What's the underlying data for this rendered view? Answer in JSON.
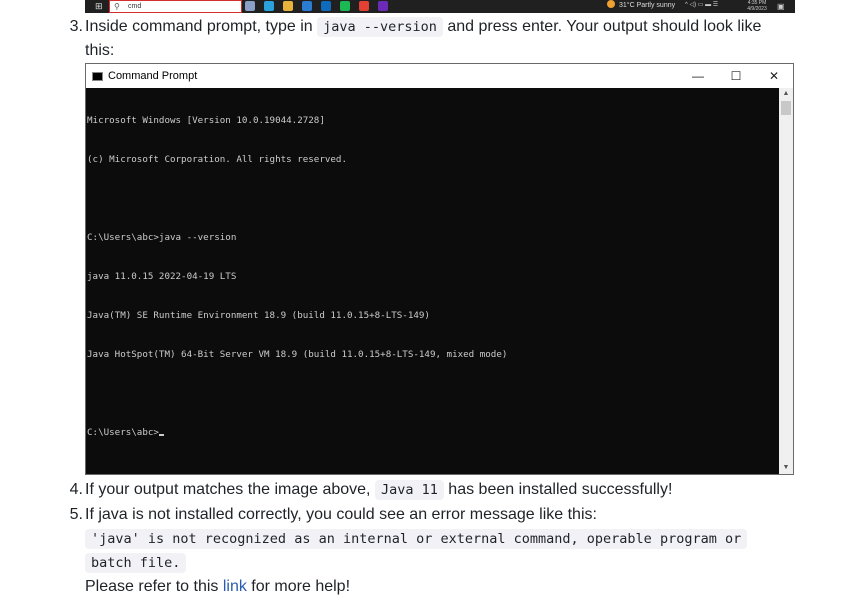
{
  "taskbar": {
    "search_text": "cmd",
    "weather": "31°C  Partly sunny",
    "clock_time": "4:35 PM",
    "clock_date": "4/9/2023",
    "icons": [
      {
        "name": "task-view-icon",
        "color": "#8aa0c8"
      },
      {
        "name": "telegram-icon",
        "color": "#2aa1da"
      },
      {
        "name": "file-explorer-icon",
        "color": "#e8b33b"
      },
      {
        "name": "mail-icon",
        "color": "#2b7cd3"
      },
      {
        "name": "outlook-icon",
        "color": "#0f6cbd"
      },
      {
        "name": "spotify-icon",
        "color": "#1db954"
      },
      {
        "name": "chrome-icon",
        "color": "#e34133"
      },
      {
        "name": "terminal-app-icon",
        "color": "#6b2bb8"
      }
    ]
  },
  "steps": [
    {
      "number": "3.",
      "before": "Inside command prompt, type in ",
      "code": "java --version",
      "after": " and press enter. Your output should look like",
      "continuation": "this:"
    },
    {
      "number": "4.",
      "before": "If your output matches the image above, ",
      "code": "Java 11",
      "after": " has been installed successfully!"
    },
    {
      "number": "5.",
      "before": "If java is not installed correctly, you could see an error message like this:",
      "code_line1": "'java' is not recognized as an internal or external command, operable program or",
      "code_line2": "batch file.",
      "refer_before": "Please refer to this ",
      "link_text": "link",
      "refer_after": " for more help!"
    }
  ],
  "cmd_window": {
    "title": "Command Prompt",
    "minimize": "—",
    "maximize": "☐",
    "close": "✕",
    "lines": [
      "Microsoft Windows [Version 10.0.19044.2728]",
      "(c) Microsoft Corporation. All rights reserved.",
      "",
      "C:\\Users\\abc>java --version",
      "java 11.0.15 2022-04-19 LTS",
      "Java(TM) SE Runtime Environment 18.9 (build 11.0.15+8-LTS-149)",
      "Java HotSpot(TM) 64-Bit Server VM 18.9 (build 11.0.15+8-LTS-149, mixed mode)",
      ""
    ],
    "prompt": "C:\\Users\\abc>"
  }
}
